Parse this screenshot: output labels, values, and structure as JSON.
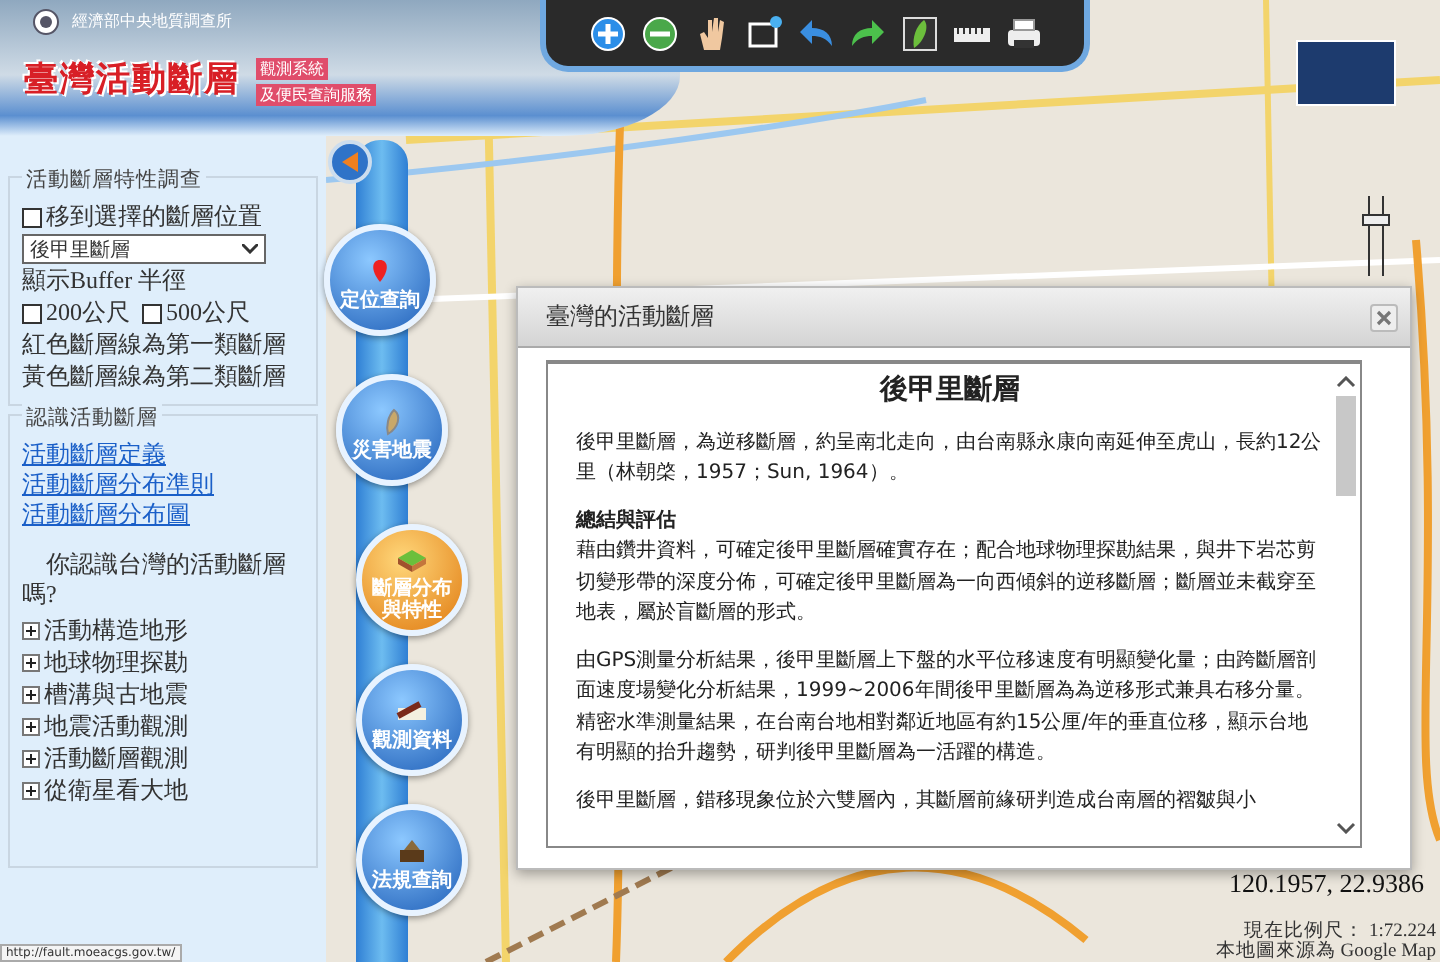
{
  "header": {
    "organization": "經濟部中央地質調查所",
    "title": "臺灣活動斷層",
    "subtitle_lines": [
      "觀測系統",
      "及便民查詢服務"
    ]
  },
  "sidebar": {
    "survey": {
      "legend": "活動斷層特性調查",
      "move_checkbox": {
        "label": "移到選擇的斷層位置",
        "checked": false
      },
      "fault_select": {
        "value": "後甲里斷層"
      },
      "buffer_label": "顯示Buffer 半徑",
      "buffer_options": [
        {
          "label": "200公尺",
          "checked": false
        },
        {
          "label": "500公尺",
          "checked": false
        }
      ],
      "notes": [
        "紅色斷層線為第一類斷層",
        "黃色斷層線為第二類斷層"
      ]
    },
    "learn": {
      "legend": "認識活動斷層",
      "links": [
        "活動斷層定義",
        "活動斷層分布準則",
        "活動斷層分布圖"
      ],
      "question": "你認識台灣的活動斷層嗎?",
      "topics": [
        {
          "label": "活動構造地形",
          "expanded": false
        },
        {
          "label": "地球物理探勘",
          "expanded": false
        },
        {
          "label": "槽溝與古地震",
          "expanded": false
        },
        {
          "label": "地震活動觀測",
          "expanded": false
        },
        {
          "label": "活動斷層觀測",
          "expanded": false
        },
        {
          "label": "從衛星看大地",
          "expanded": false
        }
      ]
    }
  },
  "nav_buttons": [
    {
      "label": "定位查詢",
      "selected": false
    },
    {
      "label": "災害地震",
      "selected": false
    },
    {
      "label": "斷層分布與特性",
      "selected": true
    },
    {
      "label": "觀測資料",
      "selected": false
    },
    {
      "label": "法規查詢",
      "selected": false
    }
  ],
  "dialog": {
    "title": "臺灣的活動斷層",
    "heading": "後甲里斷層",
    "sections": [
      {
        "text": "後甲里斷層，為逆移斷層，約呈南北走向，由台南縣永康向南延伸至虎山，長約12公里（林朝棨，1957；Sun, 1964）。"
      },
      {
        "title": "總結與評估",
        "text": "藉由鑽井資料，可確定後甲里斷層確實存在；配合地球物理探勘結果，與井下岩芯剪切變形帶的深度分佈，可確定後甲里斷層為一向西傾斜的逆移斷層；斷層並未截穿至地表，屬於盲斷層的形式。"
      },
      {
        "text": "由GPS測量分析結果，後甲里斷層上下盤的水平位移速度有明顯變化量；由跨斷層剖面速度場變化分析結果，1999~2006年間後甲里斷層為為逆移形式兼具右移分量。精密水準測量結果，在台南台地相對鄰近地區有約15公厘/年的垂直位移，顯示台地有明顯的抬升趨勢，研判後甲里斷層為一活躍的構造。"
      },
      {
        "text": "後甲里斷層，錯移現象位於六雙層內，其斷層前緣研判造成台南層的褶皺與小"
      }
    ]
  },
  "map": {
    "coordinates": "120.1957, 22.9386",
    "scale": "現在比例尺： 1:72.224",
    "source": "本地圖來源為 Google Map",
    "zoom_slider": {
      "level": 0.75
    }
  },
  "status_url": "http://fault.moeacgs.gov.tw/"
}
